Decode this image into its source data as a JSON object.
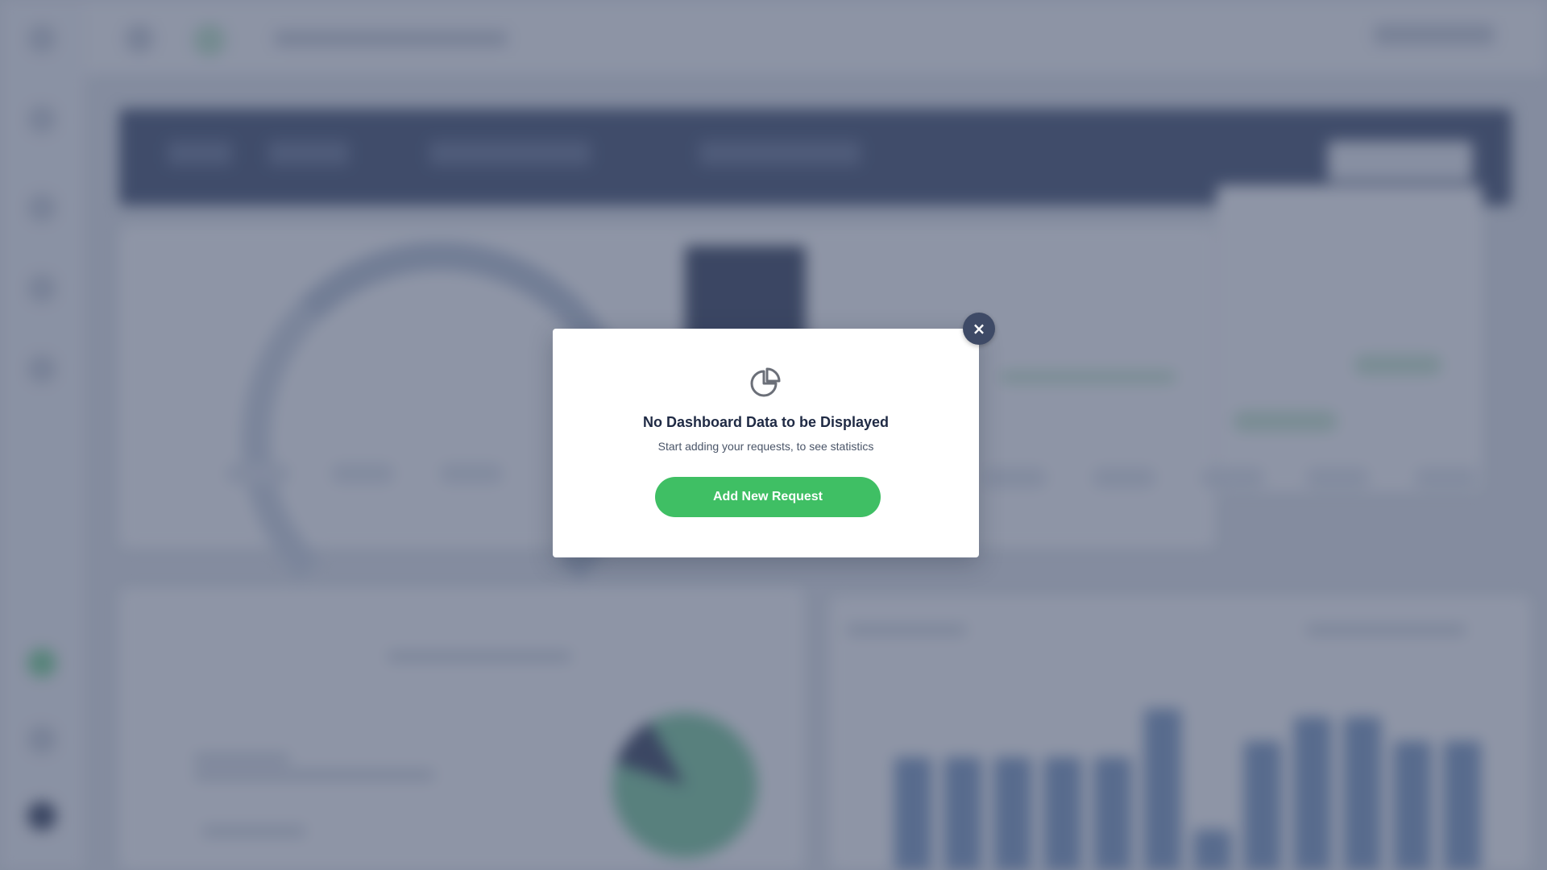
{
  "modal": {
    "title": "No Dashboard Data to be Displayed",
    "subtitle": "Start adding your requests, to see statistics",
    "primary_button_label": "Add New Request",
    "close_label": "×",
    "icon": "pie-chart-icon"
  },
  "colors": {
    "accent_green": "#3fbf64",
    "overlay": "#384460",
    "close_button": "#3e4a66",
    "title_text": "#1f2a44"
  }
}
